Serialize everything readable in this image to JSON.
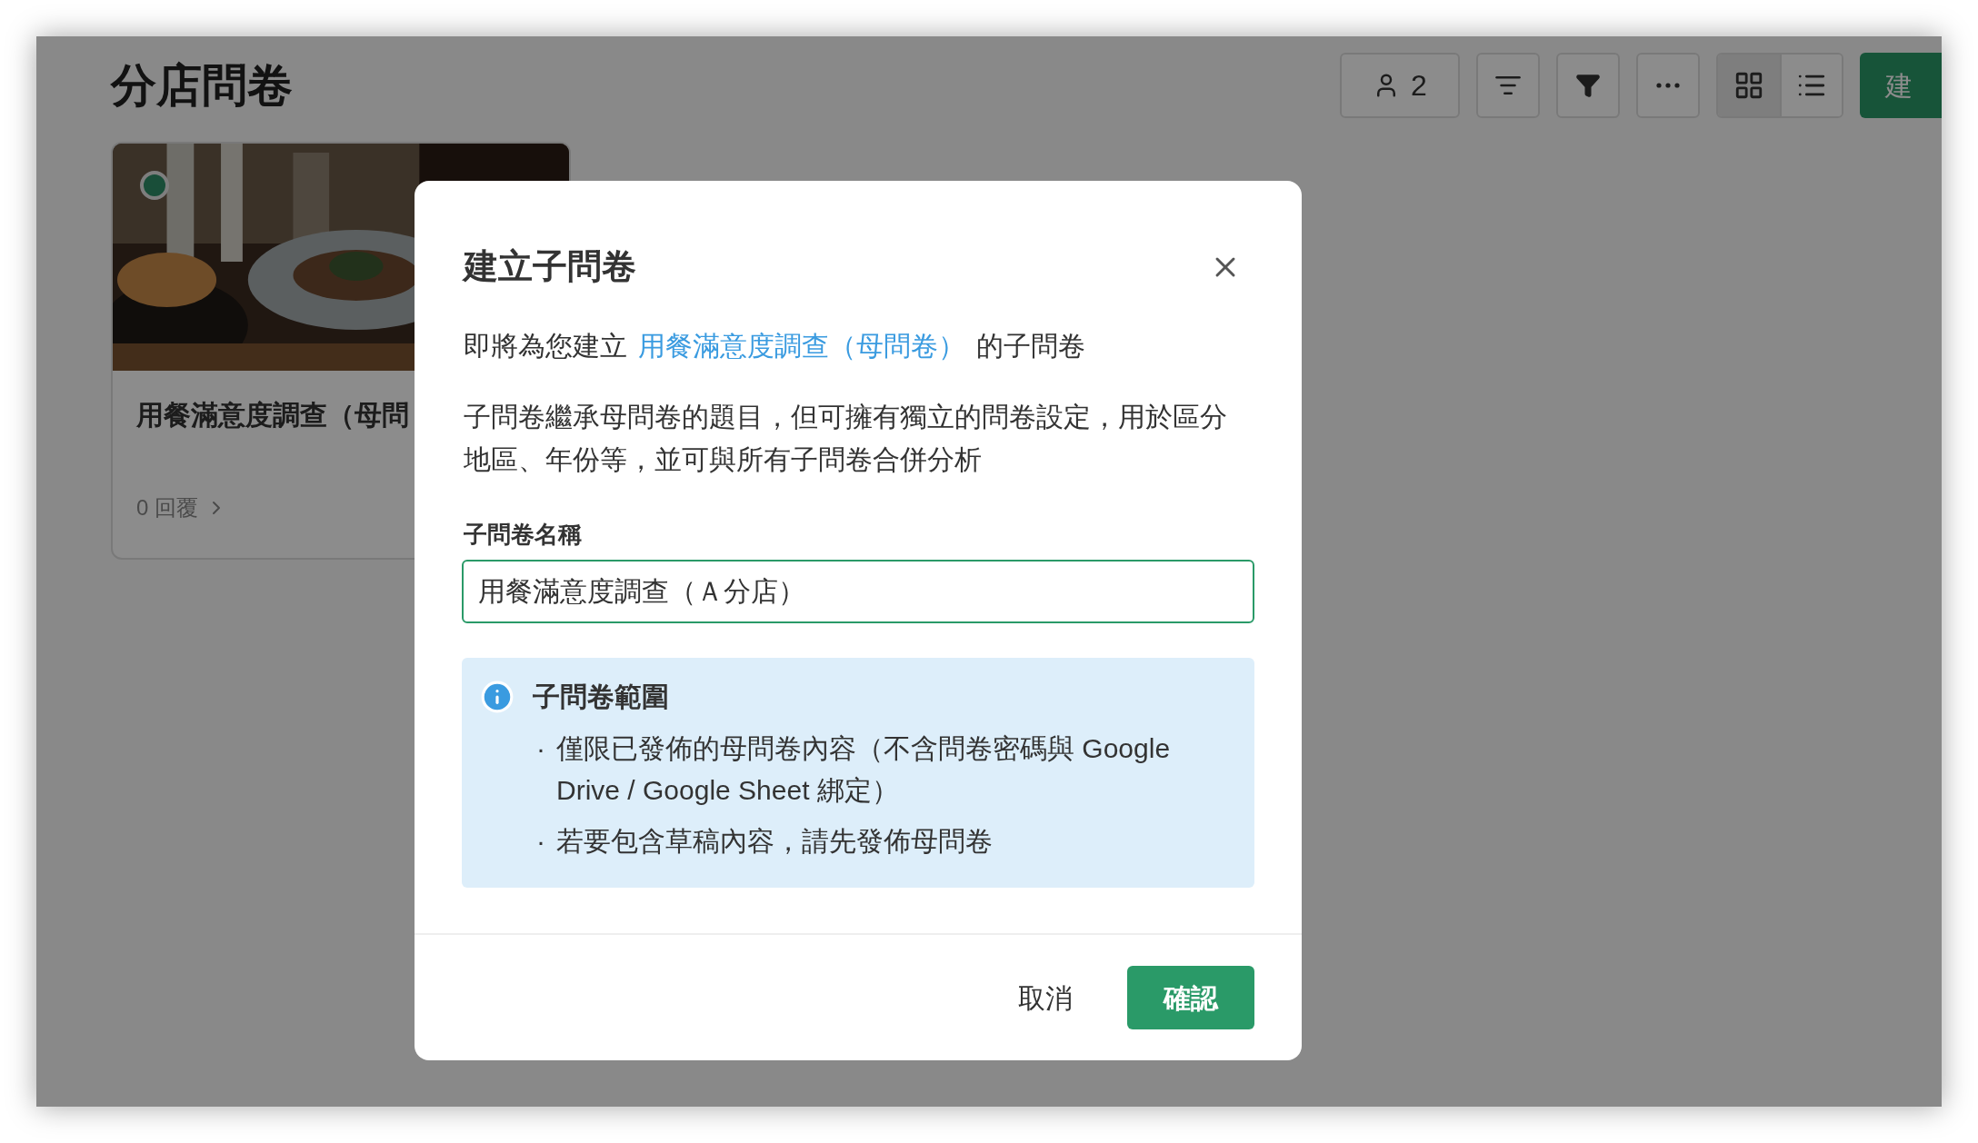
{
  "page": {
    "title": "分店問卷"
  },
  "toolbar": {
    "members": {
      "count": "2"
    },
    "view_modes": [
      {
        "kind": "grid",
        "selected": true
      },
      {
        "kind": "list",
        "selected": false
      }
    ],
    "create_button": "建"
  },
  "cards": [
    {
      "title": "用餐滿意度調查（母問",
      "responses": "0 回覆"
    }
  ],
  "dialog": {
    "title": "建立子問卷",
    "intro_prefix": "即將為您建立",
    "intro_link": "用餐滿意度調查（母問卷）",
    "intro_suffix": "的子問卷",
    "description": "子問卷繼承母問卷的題目，但可擁有獨立的問卷設定，用於區分地區、年份等，並可與所有子問卷合併分析",
    "name_field": {
      "label": "子問卷名稱",
      "value": "用餐滿意度調查（Ａ分店）"
    },
    "info": {
      "title": "子問卷範圍",
      "bullet": "·",
      "items": [
        "僅限已發佈的母問卷內容（不含問卷密碼與 Google Drive / Google Sheet 綁定）",
        "若要包含草稿內容，請先發佈母問卷"
      ]
    },
    "buttons": {
      "cancel": "取消",
      "confirm": "確認"
    }
  }
}
